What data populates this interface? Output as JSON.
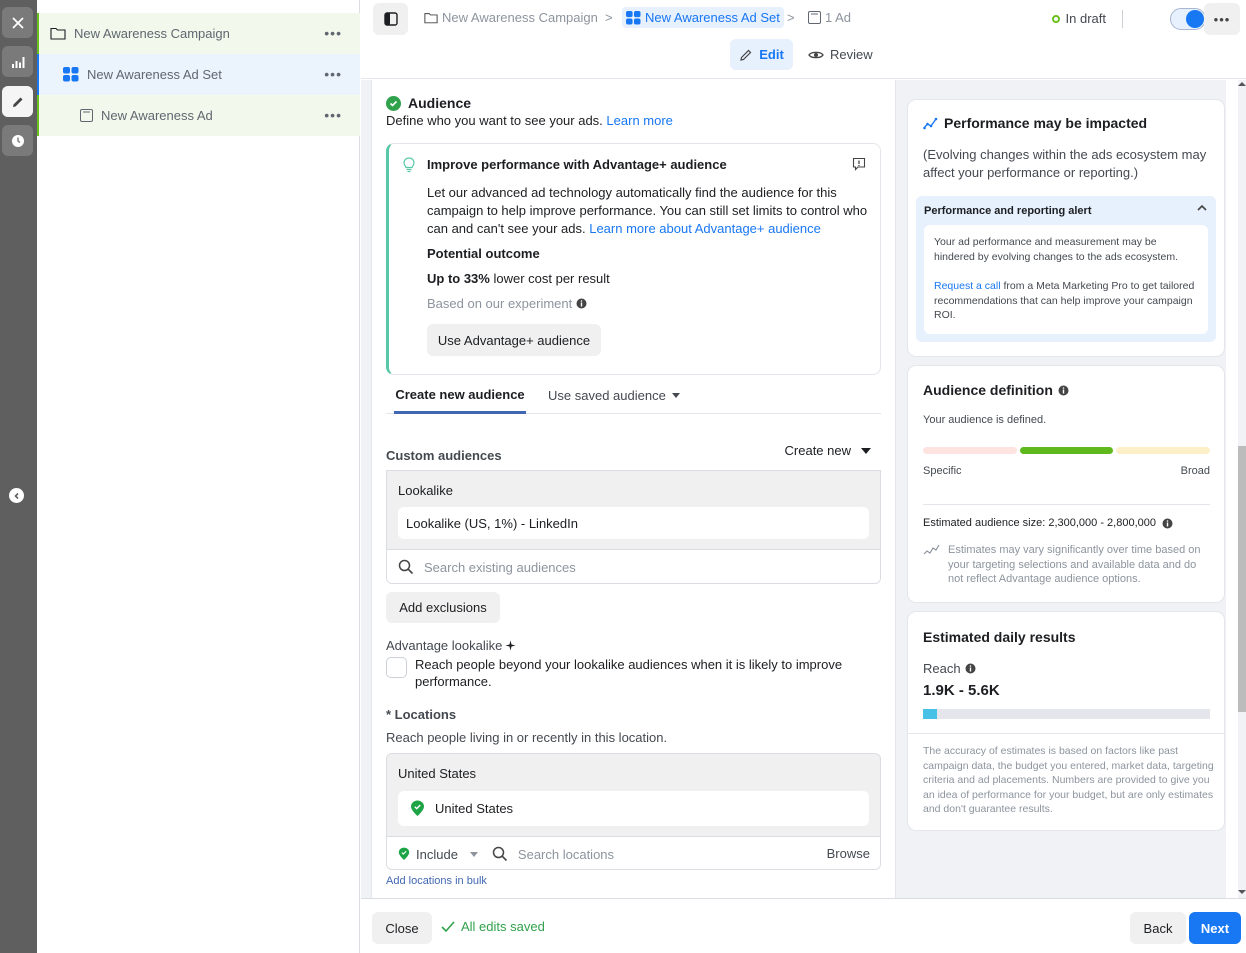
{
  "rail": {
    "buttons": [
      "close",
      "reporting",
      "edit",
      "history"
    ],
    "active": "edit"
  },
  "tree": {
    "items": [
      {
        "label": "New Awareness Campaign",
        "icon": "folder-icon",
        "level": 0
      },
      {
        "label": "New Awareness Ad Set",
        "icon": "grid-icon",
        "level": 1,
        "selected": true
      },
      {
        "label": "New Awareness Ad",
        "icon": "ad-icon",
        "level": 2
      }
    ],
    "more_label": "•••"
  },
  "header": {
    "breadcrumbs": [
      {
        "label": "New Awareness Campaign",
        "icon": "folder-icon"
      },
      {
        "label": "New Awareness Ad Set",
        "icon": "grid-icon",
        "current": true
      },
      {
        "label": "1 Ad",
        "icon": "ad-icon"
      }
    ],
    "separator": ">",
    "status": "In draft",
    "toggle_on": true,
    "more_label": "•••",
    "modes": {
      "edit": "Edit",
      "review": "Review"
    }
  },
  "audience": {
    "title": "Audience",
    "subtitle": "Define who you want to see your ads.",
    "learn_more": "Learn more",
    "advantage": {
      "title": "Improve performance with Advantage+ audience",
      "body": "Let our advanced ad technology automatically find the audience for this campaign to help improve performance. You can still set limits to control who can and can't see your ads.",
      "link": "Learn more about Advantage+ audience",
      "potential_label": "Potential outcome",
      "up_to_bold": "Up to 33%",
      "up_to_rest": "lower cost per result",
      "experiment": "Based on our experiment",
      "button": "Use Advantage+ audience"
    },
    "tabs": {
      "create": "Create new audience",
      "saved": "Use saved audience"
    },
    "custom_audiences_label": "Custom audiences",
    "create_new": "Create new",
    "lookalike": {
      "group_label": "Lookalike",
      "selected": "Lookalike (US, 1%) - LinkedIn",
      "search_placeholder": "Search existing audiences"
    },
    "add_exclusions": "Add exclusions",
    "advantage_lookalike": {
      "label": "Advantage lookalike",
      "checked": false,
      "description": "Reach people beyond your lookalike audiences when it is likely to improve performance."
    },
    "locations": {
      "title": "* Locations",
      "subtitle": "Reach people living in or recently in this location.",
      "group_label": "United States",
      "selected": "United States",
      "include_label": "Include",
      "search_placeholder": "Search locations",
      "browse": "Browse",
      "bulk": "Add locations in bulk"
    }
  },
  "side": {
    "performance": {
      "title": "Performance may be impacted",
      "subtitle": "(Evolving changes within the ads ecosystem may affect your performance or reporting.)",
      "alert_title": "Performance and reporting alert",
      "alert_p1": "Your ad performance and measurement may be hindered by evolving changes to the ads ecosystem.",
      "alert_link": "Request a call",
      "alert_p2": "from a Meta Marketing Pro to get tailored recommendations that can help improve your campaign ROI."
    },
    "audience_definition": {
      "title": "Audience definition",
      "status": "Your audience is defined.",
      "meter_state": "defined",
      "meter_colors": {
        "specific": "#fde4e1",
        "defined": "#5fb91d",
        "broad": "#fdf0c9"
      },
      "specific": "Specific",
      "broad": "Broad",
      "size_label": "Estimated audience size: 2,300,000 - 2,800,000",
      "note": "Estimates may vary significantly over time based on your targeting selections and available data and do not reflect Advantage audience options."
    },
    "daily_results": {
      "title": "Estimated daily results",
      "reach_label": "Reach",
      "reach_value": "1.9K - 5.6K",
      "reach_fill_pct": 5,
      "note": "The accuracy of estimates is based on factors like past campaign data, the budget you entered, market data, targeting criteria and ad placements. Numbers are provided to give you an idea of performance for your budget, but are only estimates and don't guarantee results."
    }
  },
  "footer": {
    "close": "Close",
    "saved": "All edits saved",
    "back": "Back",
    "next": "Next"
  },
  "colors": {
    "accent": "#1877f2",
    "success": "#31a24c",
    "draft": "#6bbf1f"
  }
}
